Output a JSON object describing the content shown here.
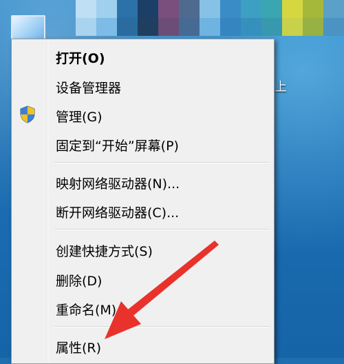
{
  "desktop": {
    "icon_label": "",
    "right_text": "上"
  },
  "context_menu": {
    "items": [
      {
        "label": "打开(O)"
      },
      {
        "label": "设备管理器"
      },
      {
        "label": "管理(G)",
        "icon": "uac-shield-icon"
      },
      {
        "label": "固定到“开始”屏幕(P)"
      },
      {
        "label": "映射网络驱动器(N)..."
      },
      {
        "label": "断开网络驱动器(C)..."
      },
      {
        "label": "创建快捷方式(S)"
      },
      {
        "label": "删除(D)"
      },
      {
        "label": "重命名(M)"
      },
      {
        "label": "属性(R)"
      }
    ]
  },
  "colors": {
    "menu_background": "#f0f0f0",
    "arrow": "#e8322b",
    "desktop": "#1f6fb0"
  }
}
